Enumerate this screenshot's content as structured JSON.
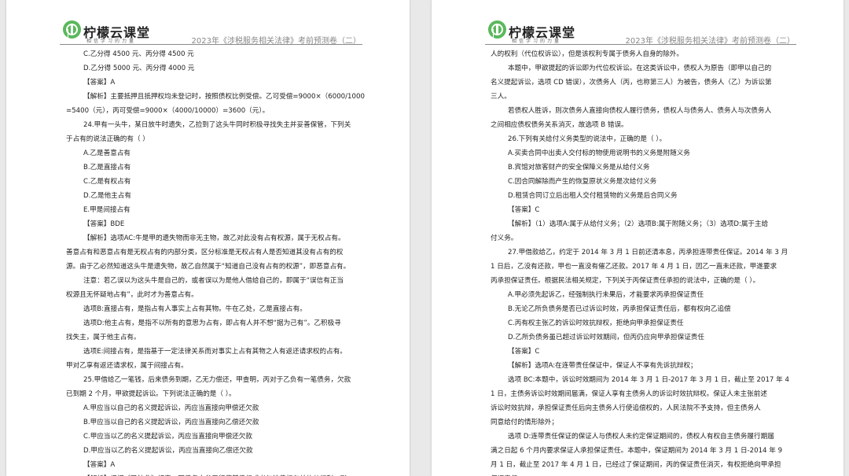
{
  "header": {
    "brand": "柠檬云课堂",
    "slogan": "相信学习的力量",
    "doc_title": "2023年《涉税服务相关法律》考前预测卷（二）"
  },
  "left_page": {
    "lines": [
      {
        "text": "C.乙分得 4500 元、丙分得 4500 元",
        "indent": true
      },
      {
        "text": "D.乙分得 5000 元、丙分得 4000 元",
        "indent": true
      },
      {
        "text": "【答案】A",
        "indent": true
      },
      {
        "text": "【解析】主要抵押且抵押权均未登记时，按照债权比例受偿。乙可受偿=9000×（6000/10000）",
        "indent": true
      },
      {
        "text": "=5400（元），丙可受偿=9000×（4000/10000）=3600（元）。",
        "indent": false
      },
      {
        "text": "24.甲有一头牛，某日放牛时遗失，乙捡到了这头牛同时积极寻找失主并妥善保管，下列关",
        "indent": true
      },
      {
        "text": "于占有的说法正确的有（    ）",
        "indent": false
      },
      {
        "text": "A.乙是善意占有",
        "indent": true
      },
      {
        "text": "B.乙是直接占有",
        "indent": true
      },
      {
        "text": "C.乙是有权占有",
        "indent": true
      },
      {
        "text": "D.乙是他主占有",
        "indent": true
      },
      {
        "text": "E.甲是间接占有",
        "indent": true
      },
      {
        "text": "【答案】BDE",
        "indent": true
      },
      {
        "text": "【解析】选项AC:牛是甲的遗失物而非无主物，故乙对此没有占有权源，属于无权占有。",
        "indent": true
      },
      {
        "text": "善意占有和恶意占有是无权占有的内部分类，区分标准是无权占有人是否知道其没有占有的权",
        "indent": false
      },
      {
        "text": "源。由于乙必然知道这头牛是遗失物，故乙自然属于“知道自己没有占有的权源”，即恶意占有。",
        "indent": false
      },
      {
        "text": "注意：若乙误以为这头牛是自己的，或者误以为是他人借给自己的，即属于“误信有正当",
        "indent": true
      },
      {
        "text": "权源且无怀疑地占有”，此时才为善意占有。",
        "indent": false
      },
      {
        "text": "选项B:直接占有，是指占有人事实上占有其物。牛在乙处，乙是直接占有。",
        "indent": true
      },
      {
        "text": "选项D:他主占有，是指不以所有的意思为占有，即占有人并不想“据为己有”。乙积极寻",
        "indent": true
      },
      {
        "text": "找失主，属于他主占有。",
        "indent": false
      },
      {
        "text": "选项E:间接占有，是指基于一定法律关系而对事实上占有其物之人有返还请求权的占有。",
        "indent": true
      },
      {
        "text": "甲对乙享有返还请求权，属于间接占有。",
        "indent": false
      },
      {
        "text": "25.甲借给乙一笔钱，后来债务到期，乙无力偿还，甲查明，丙对于乙负有一笔债务，欠款",
        "indent": true
      },
      {
        "text": "已到期 2 个月，甲欲提起诉讼。下列说法正确的是（    ）。",
        "indent": false
      },
      {
        "text": "A.甲应当以自己的名义提起诉讼，丙应当直接向甲偿还欠款",
        "indent": true
      },
      {
        "text": "B.甲应当以自己的名义提起诉讼，丙应当直接向乙偿还欠款",
        "indent": true
      },
      {
        "text": "C.甲应当以乙的名义提起诉讼，丙应当直接向甲偿还欠款",
        "indent": true
      },
      {
        "text": "D.甲应当以乙的名义提起诉讼，丙应当直接向乙偿还欠款",
        "indent": true
      },
      {
        "text": "【答案】A",
        "indent": true
      },
      {
        "text": "【解析】根据《民法典》规定，因债务人怠于行使其债权或者与该债权有关的从权利，影",
        "indent": true
      }
    ]
  },
  "right_page": {
    "lines": [
      {
        "text": "人的权利（代位权诉讼），但是该权利专属于债务人自身的除外。",
        "indent": false
      },
      {
        "text": "本题中，甲欲提起的诉讼即为代位权诉讼。在这类诉讼中，债权人为原告（即甲以自己的",
        "indent": true
      },
      {
        "text": "名义提起诉讼，选项 CD 错误），次债务人（丙，也称第三人）为被告，债务人（乙）为诉讼第",
        "indent": false
      },
      {
        "text": "三人。",
        "indent": false
      },
      {
        "text": "若债权人胜诉，则次债务人直接向债权人履行债务，债权人与债务人、债务人与次债务人",
        "indent": true
      },
      {
        "text": "之间相应债权债务关系消灭，故选项 B 错误。",
        "indent": false
      },
      {
        "text": "26.下列有关给付义务类型的说法中，正确的是（    ）。",
        "indent": true
      },
      {
        "text": "A.买卖合同中出卖人交付标的物使用说明书的义务是附随义务",
        "indent": true
      },
      {
        "text": "B.宾馆对旅客财产的安全保障义务是从给付义务",
        "indent": true
      },
      {
        "text": "C.因合同解除而产生的恢复原状义务是次给付义务",
        "indent": true
      },
      {
        "text": "D.租赁合同订立后出租人交付租赁物的义务是后合同义务",
        "indent": true
      },
      {
        "text": "【答案】C",
        "indent": true
      },
      {
        "text": "【解析】（1）选项A:属于从给付义务；（2）选项B:属于附随义务；（3）选项D:属于主给",
        "indent": true
      },
      {
        "text": "付义务。",
        "indent": false
      },
      {
        "text": "27.甲借款给乙，约定于 2014 年 3 月 1 日前还清本息，丙承担连带责任保证。2014 年 3 月",
        "indent": true
      },
      {
        "text": "1 日后，乙没有还款，甲也一直没有催乙还款。2017 年 4 月 1 日，因乙一直未还款，甲遂要求",
        "indent": false
      },
      {
        "text": "丙承担保证责任。根据民法相关规定，下列关于丙保证责任承担的说法中，正确的是（    ）。",
        "indent": false
      },
      {
        "text": "A.甲必须先起诉乙，经强制执行未果后，才能要求丙承担保证责任",
        "indent": true
      },
      {
        "text": "B.无论乙所负债务是否已过诉讼时效，丙承担保证责任后，都有权向乙追偿",
        "indent": true
      },
      {
        "text": "C.丙有权主张乙的诉讼时效抗辩权，拒绝向甲承担保证责任",
        "indent": true
      },
      {
        "text": "D.乙所负债务虽已超过诉讼时效期间，但丙仍应向甲承担保证责任",
        "indent": true
      },
      {
        "text": "【答案】C",
        "indent": true
      },
      {
        "text": "【解析】选项A:在连带责任保证中，保证人不享有先诉抗辩权；",
        "indent": true
      },
      {
        "text": "选项 BC:本题中，诉讼时效期间为 2014 年 3 月 1 日-2017 年 3 月 1 日，截止至 2017 年 4 月",
        "indent": true
      },
      {
        "text": "1 日，主债务诉讼时效期间届满，保证人享有主债务人的诉讼时效抗辩权。保证人未主张前述",
        "indent": false
      },
      {
        "text": "诉讼时效抗辩，承担保证责任后向主债务人行使追偿权的，人民法院不予支持，但主债务人",
        "indent": false
      },
      {
        "text": "同意给付的情形除外；",
        "indent": false
      },
      {
        "text": "选项 D:连带责任保证的保证人与债权人未约定保证期间的，债权人有权自主债务履行期届",
        "indent": true
      },
      {
        "text": "满之日起 6 个月内要求保证人承担保证责任。本题中，保证期间为 2014 年 3 月 1 日-2014 年 9",
        "indent": false
      },
      {
        "text": "月 1 日，截止至 2017 年 4 月 1 日，已经过了保证期间，丙的保证责任消灭，有权拒绝向甲承担",
        "indent": false
      },
      {
        "text": "保证责任。",
        "indent": false
      }
    ]
  }
}
